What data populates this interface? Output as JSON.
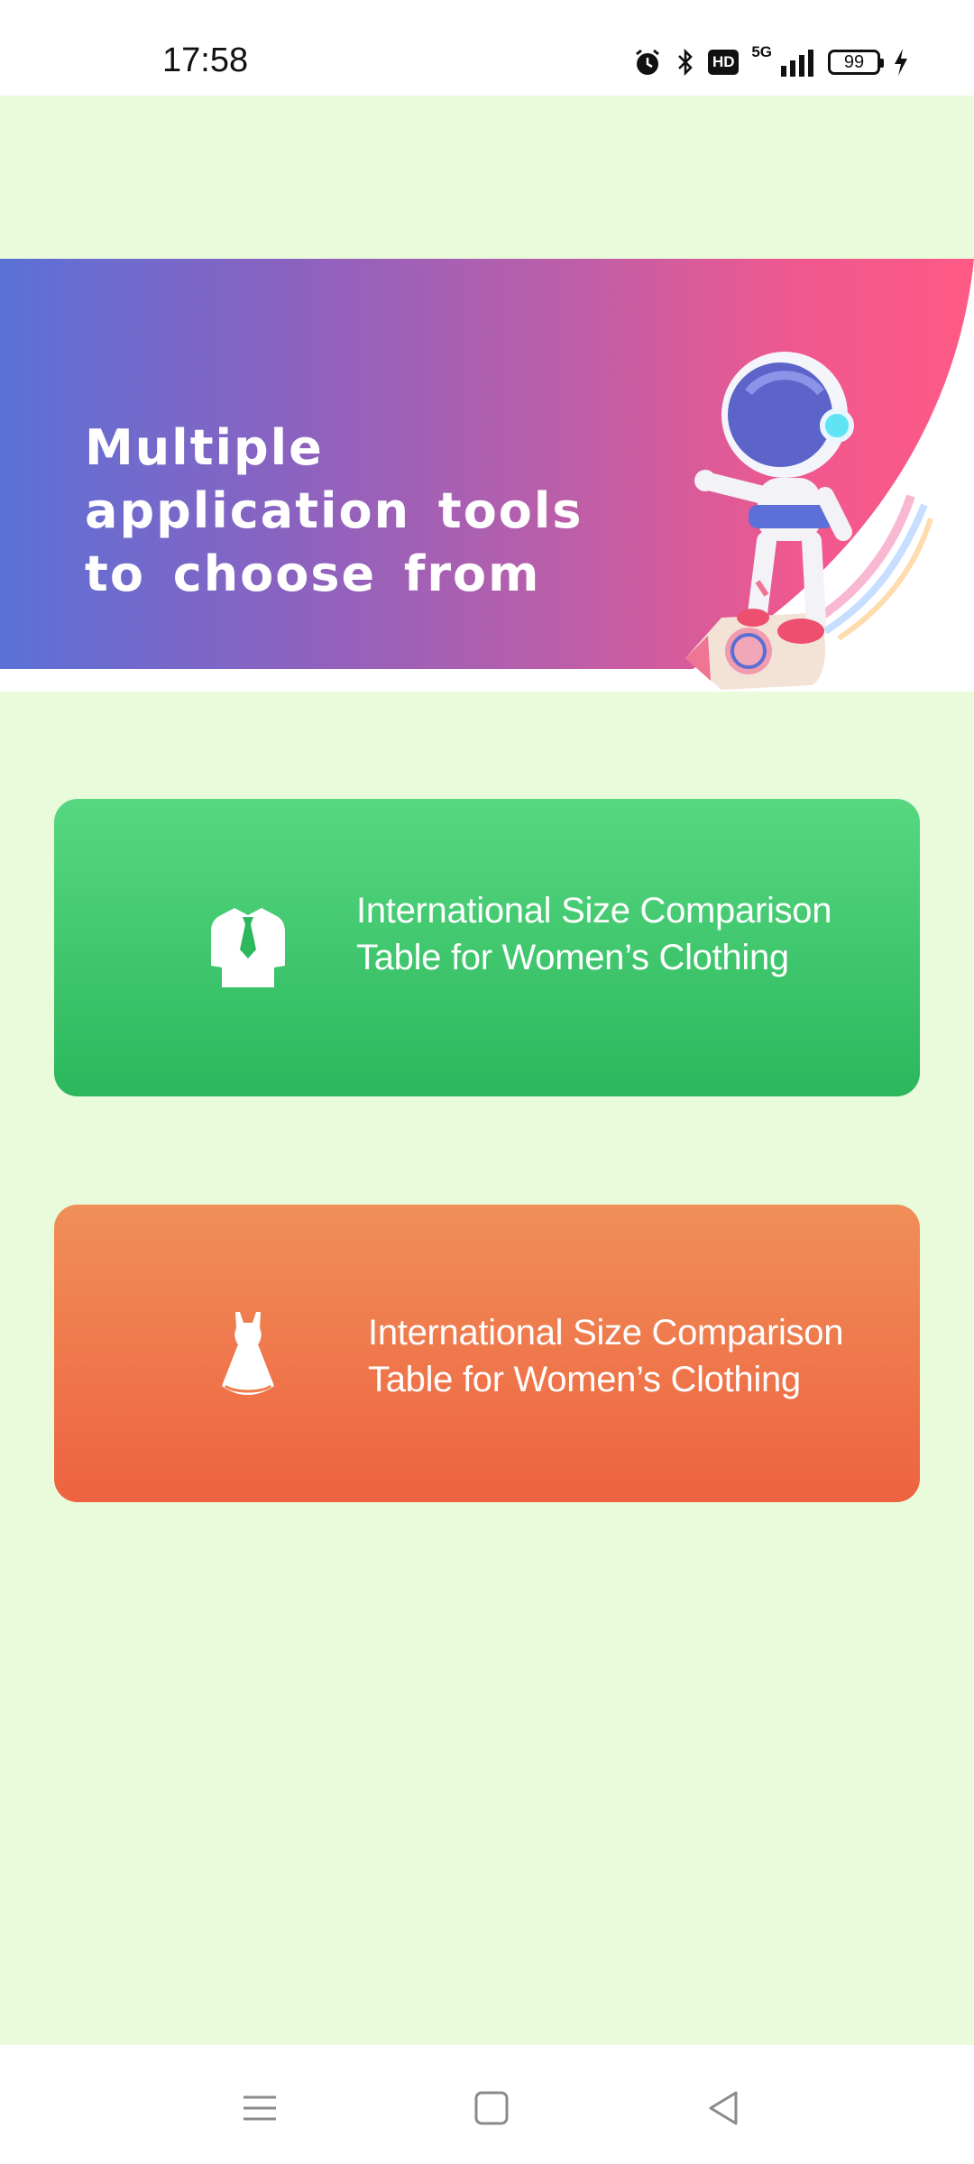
{
  "status_bar": {
    "time": "17:58",
    "network": "5G",
    "hd_badge": "HD",
    "battery_level": "99",
    "icons": [
      "alarm-icon",
      "bluetooth-icon",
      "hd-icon",
      "signal-icon",
      "battery-icon",
      "charging-icon"
    ]
  },
  "banner": {
    "title_line1": "Multiple application tools",
    "title_line2": "to choose from",
    "colors": {
      "start": "#5b71d6",
      "end": "#ff5a86"
    }
  },
  "tools": [
    {
      "label_line1": "International Size Comparison",
      "label_line2": "Table for Women’s Clothing",
      "icon": "shirt-tie-icon",
      "color": "#3cc76b"
    },
    {
      "label_line1": "International Size Comparison",
      "label_line2": "Table for Women’s Clothing",
      "icon": "dress-icon",
      "color": "#ef7349"
    }
  ],
  "nav_bar": {
    "buttons": [
      "menu-icon",
      "home-icon",
      "back-icon"
    ]
  },
  "colors": {
    "background": "#eafbdc"
  }
}
